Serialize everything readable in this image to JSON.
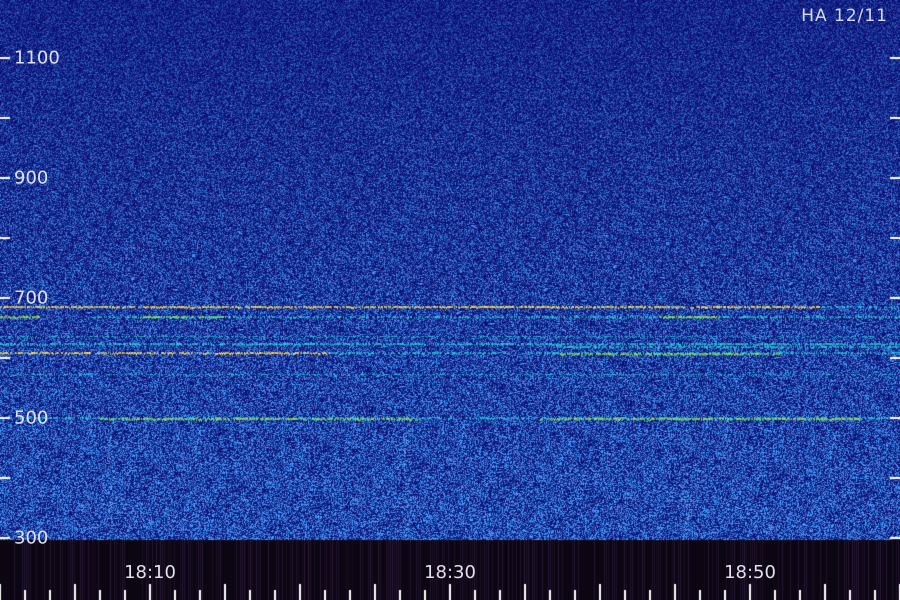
{
  "station_label": "HA 12/11",
  "colors": {
    "background": "#00007a",
    "noise_high": "#2a6bff",
    "band_cyan": "#22d3d3",
    "band_green": "#9be43a",
    "band_yellow": "#ffe04a",
    "footer": "#0c0612",
    "tick": "#ffffff"
  },
  "y_axis": {
    "ticks": [
      "1100",
      "900",
      "700",
      "500",
      "300"
    ]
  },
  "x_axis": {
    "ticks": [
      "18:10",
      "18:30",
      "18:50"
    ]
  }
}
